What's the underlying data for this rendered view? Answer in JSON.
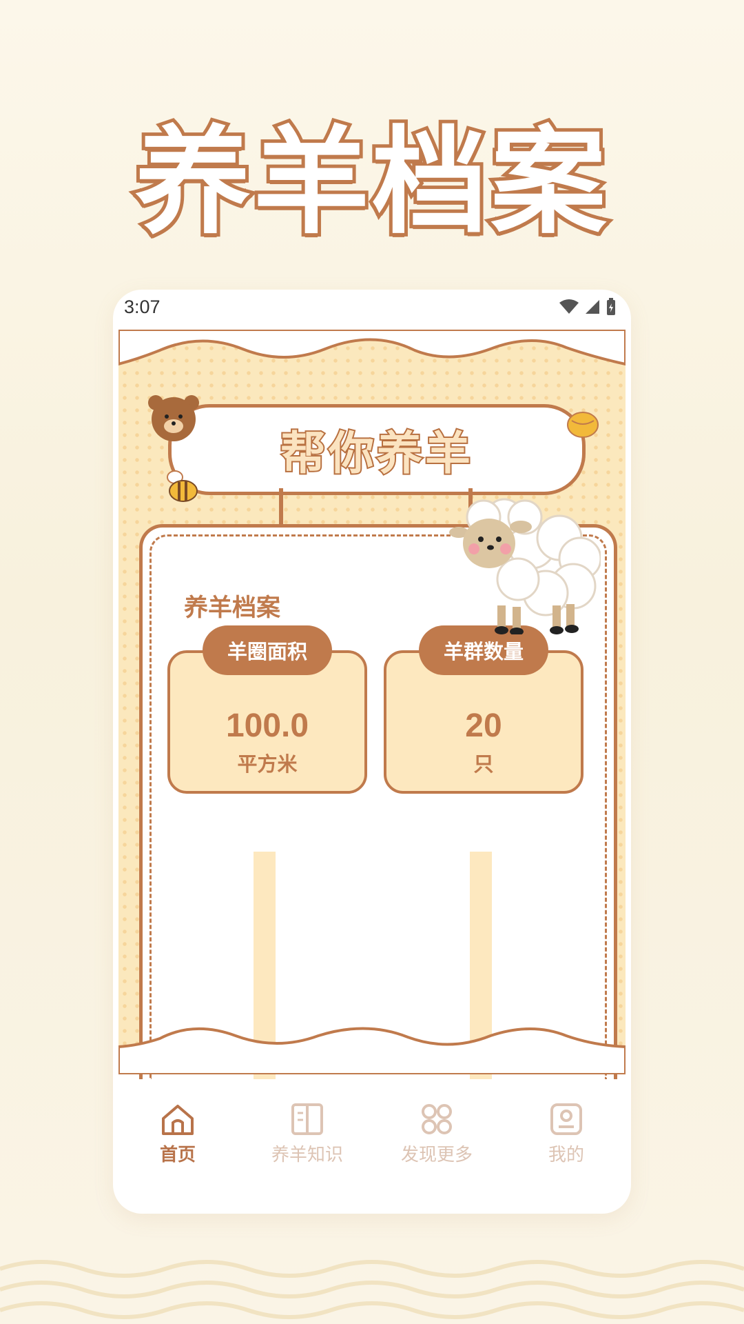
{
  "poster": {
    "title": "养羊档案"
  },
  "status_bar": {
    "time": "3:07"
  },
  "header": {
    "banner_title": "帮你养羊"
  },
  "main": {
    "section_title": "养羊档案",
    "stats": [
      {
        "tag": "羊圈面积",
        "value": "100.0",
        "unit": "平方米"
      },
      {
        "tag": "羊群数量",
        "value": "20",
        "unit": "只"
      }
    ]
  },
  "tabbar": {
    "items": [
      {
        "label": "首页",
        "icon": "home-icon",
        "active": true
      },
      {
        "label": "养羊知识",
        "icon": "book-icon",
        "active": false
      },
      {
        "label": "发现更多",
        "icon": "grid-icon",
        "active": false
      },
      {
        "label": "我的",
        "icon": "profile-icon",
        "active": false
      }
    ]
  },
  "colors": {
    "accent": "#c07a4c",
    "card_fill": "#fde8bf",
    "inactive_tab": "#ddc4b4"
  }
}
